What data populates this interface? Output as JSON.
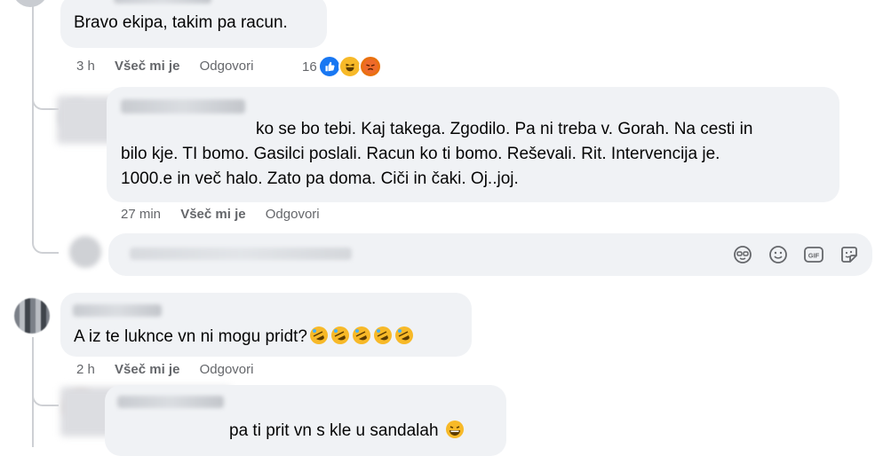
{
  "comments": [
    {
      "author": "",
      "text": "Bravo ekipa, takim pa racun.",
      "time": "3 h",
      "like_label": "Všeč mi je",
      "reply_label": "Odgovori",
      "reaction_count": "16"
    },
    {
      "author": "",
      "text_line1": "ko se bo tebi. Kaj takega. Zgodilo. Pa ni treba v. Gorah. Na cesti in",
      "text_line2": "bilo kje. TI bomo. Gasilci poslali. Racun ko ti bomo. Reševali. Rit. Intervencija je.",
      "text_line3": "1000.e in več halo. Zato pa doma. Ciči in čaki. Oj..joj.",
      "time": "27 min",
      "like_label": "Všeč mi je",
      "reply_label": "Odgovori"
    },
    {
      "author": "",
      "text": "A iz te luknce vn ni mogu pridt?",
      "time": "2 h",
      "like_label": "Všeč mi je",
      "reply_label": "Odgovori"
    },
    {
      "author": "",
      "text": "pa ti prit vn s kle u sandalah"
    }
  ],
  "composer": {
    "placeholder": "",
    "tools": [
      "avatar-sticker-icon",
      "emoji-icon",
      "gif-icon",
      "sticker-icon"
    ],
    "gif_label": "GIF"
  },
  "colors": {
    "bubble": "#f0f2f5",
    "meta": "#65676b",
    "like": "#1877f2",
    "thread": "#ced0d4"
  }
}
